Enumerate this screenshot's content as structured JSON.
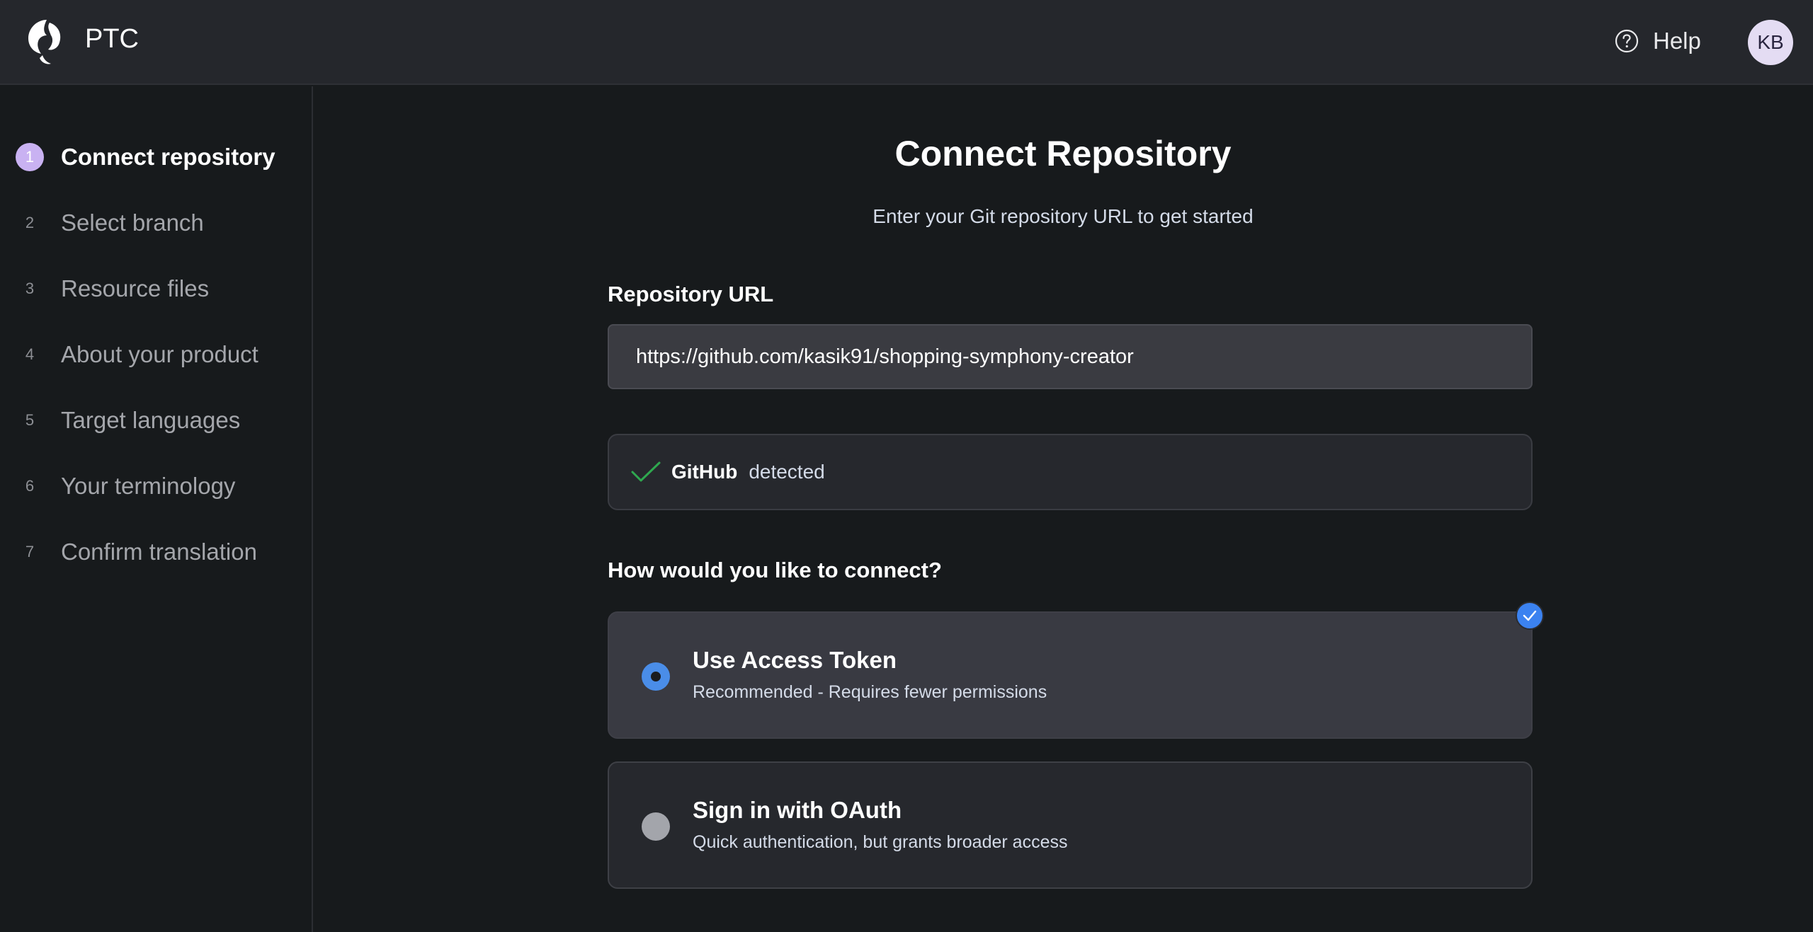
{
  "header": {
    "brand": "PTC",
    "help_label": "Help",
    "avatar_initials": "KB"
  },
  "sidebar": {
    "steps": [
      {
        "number": "1",
        "label": "Connect repository",
        "active": true
      },
      {
        "number": "2",
        "label": "Select branch",
        "active": false
      },
      {
        "number": "3",
        "label": "Resource files",
        "active": false
      },
      {
        "number": "4",
        "label": "About your product",
        "active": false
      },
      {
        "number": "5",
        "label": "Target languages",
        "active": false
      },
      {
        "number": "6",
        "label": "Your terminology",
        "active": false
      },
      {
        "number": "7",
        "label": "Confirm translation",
        "active": false
      }
    ]
  },
  "main": {
    "title": "Connect Repository",
    "subtitle": "Enter your Git repository URL to get started",
    "url_label": "Repository URL",
    "url_value": "https://github.com/kasik91/shopping-symphony-creator",
    "detection": {
      "provider": "GitHub",
      "status": "detected"
    },
    "question": "How would you like to connect?",
    "options": [
      {
        "title": "Use Access Token",
        "description": "Recommended - Requires fewer permissions",
        "selected": true
      },
      {
        "title": "Sign in with OAuth",
        "description": "Quick authentication, but grants broader access",
        "selected": false
      }
    ]
  },
  "colors": {
    "accent_blue": "#3b82f0",
    "active_step": "#c9b2f2",
    "success_green": "#2fa84f",
    "background": "#171a1c"
  },
  "icons": {
    "logo": "ptc-logo-icon",
    "help": "help-circle-icon",
    "detected": "checkmark-icon",
    "selected_badge": "check-badge-icon"
  }
}
